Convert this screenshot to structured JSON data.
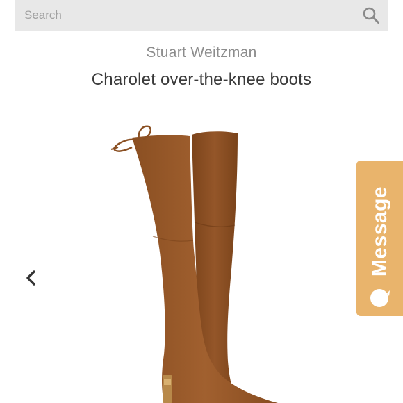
{
  "search": {
    "placeholder": "Search"
  },
  "product": {
    "brand": "Stuart Weitzman",
    "title": "Charolet over-the-knee boots"
  },
  "carousel": {
    "prev_icon": "chevron-left-icon"
  },
  "message_widget": {
    "label": "Message",
    "icon": "chat-bubble-icon"
  },
  "colors": {
    "search_bg": "#e8e8e8",
    "brand_text": "#8c8c8c",
    "title_text": "#3a3a3a",
    "message_tab": "#e9b46c",
    "boot_suede": "#9a5a2a"
  }
}
